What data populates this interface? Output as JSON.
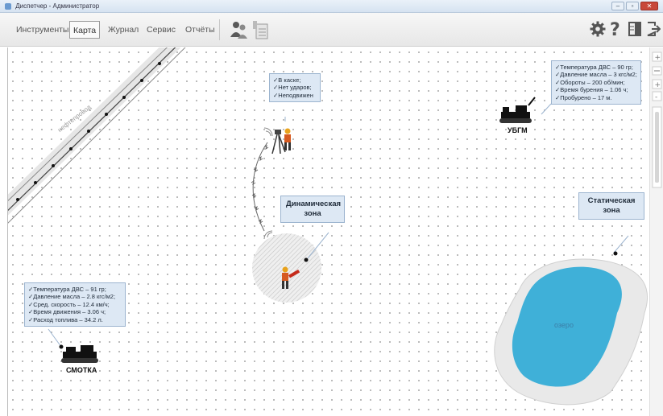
{
  "window": {
    "title": "Диспетчер - Администратор"
  },
  "toolbar": {
    "menu": [
      "Инструменты",
      "Карта",
      "Журнал",
      "Сервис",
      "Отчёты"
    ],
    "active_index": 1
  },
  "map": {
    "pipeline_label": "нефтепровод",
    "worker_status": [
      "В каске;",
      "Нет ударов;",
      "Неподвижен"
    ],
    "ubgm": {
      "label": "УБГМ",
      "stats": [
        "Температура ДВС – 90 гр;",
        "Давление масла – 3 кгс/м2;",
        "Обороты – 200 об/мин;",
        "Время бурения – 1.06 ч;",
        "Пробурено – 17 м."
      ]
    },
    "smotka": {
      "label": "СМОТКА",
      "stats": [
        "Температура ДВС – 91 гр;",
        "Давление масла – 2.8 кгс/м2;",
        "Сред. скорость – 12.4 км/ч;",
        "Время движения – 3.06 ч;",
        "Расход топлива – 34.2 л."
      ]
    },
    "dynamic_zone": {
      "line1": "Динамическая",
      "line2": "зона"
    },
    "static_zone": {
      "line1": "Статическая",
      "line2": "зона"
    },
    "lake_label": "озеро"
  },
  "colors": {
    "lake": "#3fb0d8",
    "lake_shore": "#e6e6e6",
    "info_bg": "#dde8f4",
    "info_border": "#9cb4cf",
    "pipeline": "#e4e4e4"
  },
  "icons": {
    "settings": "gear-icon",
    "help": "question-icon",
    "layout": "panel-icon",
    "exit": "exit-icon",
    "users": "users-icon",
    "report": "report-icon"
  }
}
